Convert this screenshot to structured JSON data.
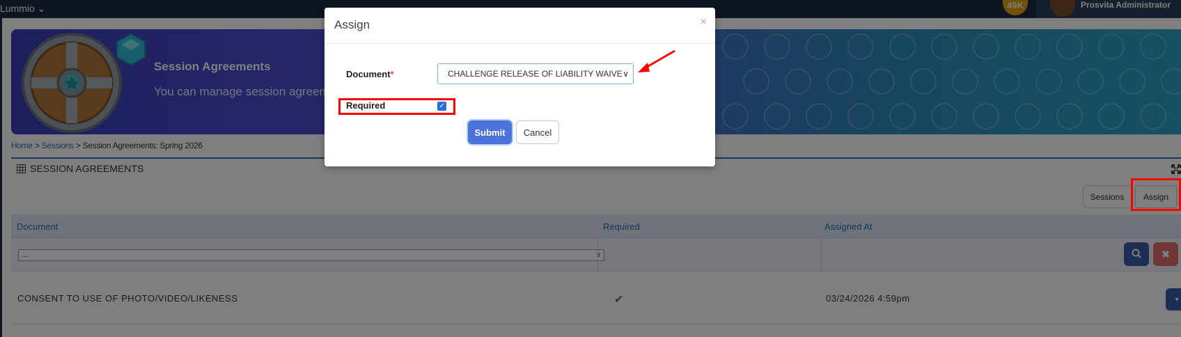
{
  "topbar": {
    "brand": "Lummio ⌄",
    "points_badge": "49K",
    "user_name": "Prosvita Administrator"
  },
  "banner": {
    "title": "Session Agreements",
    "subtitle": "You can manage session agreem"
  },
  "breadcrumb": {
    "home": "Home",
    "sessions": "Sessions",
    "current": "Session Agreements: Spring 2026",
    "separator": " > "
  },
  "panel": {
    "title": "SESSION AGREEMENTS",
    "sessions_button": "Sessions",
    "assign_button": "Assign"
  },
  "table": {
    "columns": [
      "Document",
      "Required",
      "Assigned At"
    ],
    "filter_select_value": "...",
    "rows": [
      {
        "document": "CONSENT TO USE OF PHOTO/VIDEO/LIKENESS",
        "required": true,
        "assigned_at": "03/24/2026 4:59pm"
      }
    ]
  },
  "modal": {
    "title": "Assign",
    "close": "×",
    "document_label": "Document",
    "required_star": "*",
    "document_value": "CHALLENGE RELEASE OF LIABILITY WAIVE",
    "required_label": "Required",
    "required_checked": true,
    "submit": "Submit",
    "cancel": "Cancel"
  },
  "colors": {
    "accent": "#2a6fb8",
    "submit": "#4a74dc",
    "annotation": "#ff0000",
    "topbar": "#1c2b44"
  }
}
